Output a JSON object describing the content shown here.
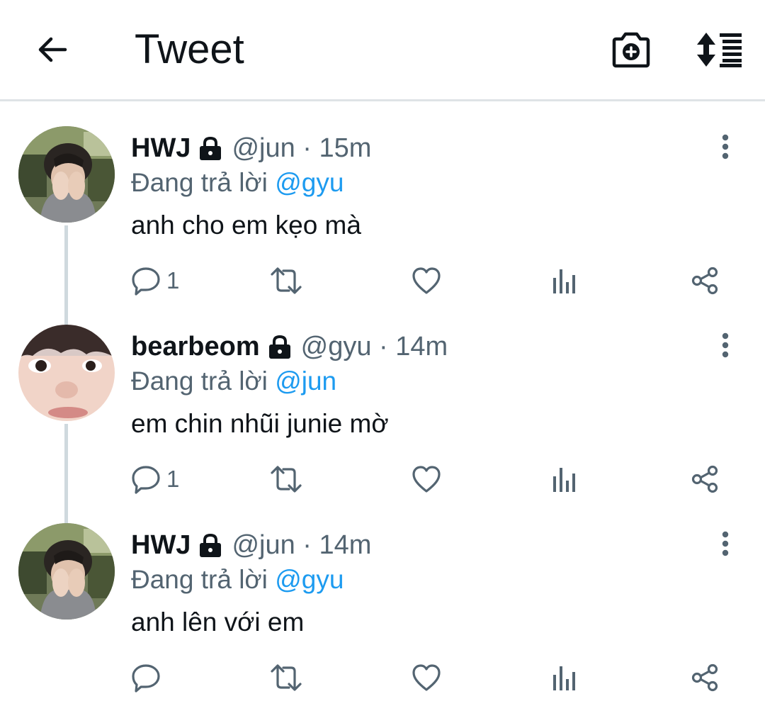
{
  "header": {
    "title": "Tweet"
  },
  "tweets": [
    {
      "display_name": "HWJ",
      "handle_time": "@jun · 15m",
      "replying_prefix": "Đang trả lời",
      "replying_to": "@gyu",
      "text": "anh cho em kẹo mà",
      "reply_count": "1"
    },
    {
      "display_name": "bearbeom",
      "handle_time": "@gyu · 14m",
      "replying_prefix": "Đang trả lời",
      "replying_to": "@jun",
      "text": "em chin nhũi junie mờ",
      "reply_count": "1"
    },
    {
      "display_name": "HWJ",
      "handle_time": "@jun · 14m",
      "replying_prefix": "Đang trả lời",
      "replying_to": "@gyu",
      "text": "anh lên với em",
      "reply_count": ""
    }
  ],
  "icons": {
    "header": [
      "back-arrow-icon",
      "camera-add-icon",
      "sort-icon"
    ],
    "tweet": [
      "lock-icon",
      "more-vertical-icon",
      "reply-icon",
      "retweet-icon",
      "like-icon",
      "analytics-icon",
      "share-icon"
    ]
  },
  "colors": {
    "accent": "#1d9bf0",
    "text": "#0f1419",
    "muted": "#536471",
    "divider": "#dfe3e6",
    "thread": "#cfd9de"
  }
}
